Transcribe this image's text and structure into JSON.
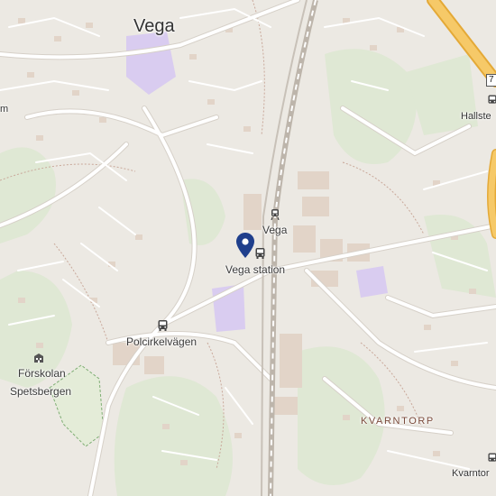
{
  "map": {
    "colors": {
      "land": "#ece9e3",
      "forest": "#dfe8d4",
      "park_purple": "#d9ccf0",
      "building": "#e2d4c8",
      "road": "#ffffff",
      "road_outline": "#d6d0c8",
      "highway": "#f6c968",
      "highway_outline": "#e4a937",
      "rail": "#bdb5ab",
      "path_dash": "#c9a89a",
      "marker": "#1f3f8c"
    },
    "places": {
      "vega": "Vega",
      "kvarntorp": "KVARNTORP"
    },
    "pois": {
      "vega_rail": "Vega",
      "vega_station": "Vega station",
      "polcirkelvagen": "Polcirkelvägen",
      "forskolan_line1": "Förskolan",
      "forskolan_line2": "Spetsbergen",
      "hallste": "Hallste",
      "kvarntor_edge": "Kvarntor",
      "left_edge_m": "m"
    },
    "route_shield": "7",
    "icons": {
      "rail": "train-icon",
      "bus": "bus-icon",
      "school": "school-icon",
      "marker": "location-pin-icon"
    }
  }
}
